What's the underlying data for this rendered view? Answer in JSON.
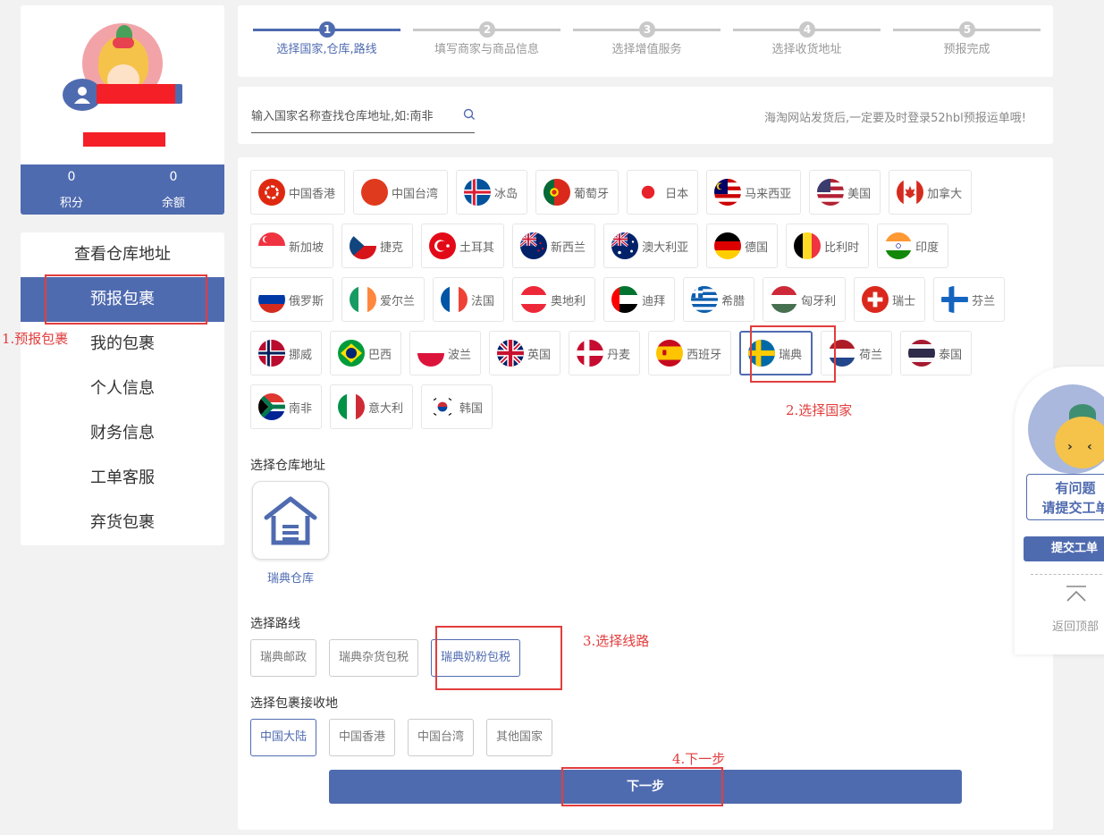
{
  "user": {
    "points_value": "0",
    "points_label": "积分",
    "balance_value": "0",
    "balance_label": "余额"
  },
  "menu": {
    "items": [
      {
        "label": "查看仓库地址"
      },
      {
        "label": "预报包裹"
      },
      {
        "label": "我的包裹"
      },
      {
        "label": "个人信息"
      },
      {
        "label": "财务信息"
      },
      {
        "label": "工单客服"
      },
      {
        "label": "弃货包裹"
      }
    ],
    "active_index": 1
  },
  "steps": [
    {
      "num": "1",
      "label": "选择国家,仓库,路线"
    },
    {
      "num": "2",
      "label": "填写商家与商品信息"
    },
    {
      "num": "3",
      "label": "选择增值服务"
    },
    {
      "num": "4",
      "label": "选择收货地址"
    },
    {
      "num": "5",
      "label": "预报完成"
    }
  ],
  "search": {
    "placeholder": "输入国家名称查找仓库地址,如:南非",
    "tip": "海淘网站发货后,一定要及时登录52hbl预报运单哦!"
  },
  "countries": [
    {
      "name": "中国香港",
      "flag": "hk-flag-icon"
    },
    {
      "name": "中国台湾",
      "flag": "tw-flag-icon"
    },
    {
      "name": "冰岛",
      "flag": "is-flag-icon"
    },
    {
      "name": "葡萄牙",
      "flag": "pt-flag-icon"
    },
    {
      "name": "日本",
      "flag": "jp-flag-icon"
    },
    {
      "name": "马来西亚",
      "flag": "my-flag-icon"
    },
    {
      "name": "美国",
      "flag": "us-flag-icon"
    },
    {
      "name": "加拿大",
      "flag": "ca-flag-icon"
    },
    {
      "name": "新加坡",
      "flag": "sg-flag-icon"
    },
    {
      "name": "捷克",
      "flag": "cz-flag-icon"
    },
    {
      "name": "土耳其",
      "flag": "tr-flag-icon"
    },
    {
      "name": "新西兰",
      "flag": "nz-flag-icon"
    },
    {
      "name": "澳大利亚",
      "flag": "au-flag-icon"
    },
    {
      "name": "德国",
      "flag": "de-flag-icon"
    },
    {
      "name": "比利时",
      "flag": "be-flag-icon"
    },
    {
      "name": "印度",
      "flag": "in-flag-icon"
    },
    {
      "name": "俄罗斯",
      "flag": "ru-flag-icon"
    },
    {
      "name": "爱尔兰",
      "flag": "ie-flag-icon"
    },
    {
      "name": "法国",
      "flag": "fr-flag-icon"
    },
    {
      "name": "奥地利",
      "flag": "at-flag-icon"
    },
    {
      "name": "迪拜",
      "flag": "ae-flag-icon"
    },
    {
      "name": "希腊",
      "flag": "gr-flag-icon"
    },
    {
      "name": "匈牙利",
      "flag": "hu-flag-icon"
    },
    {
      "name": "瑞士",
      "flag": "ch-flag-icon"
    },
    {
      "name": "芬兰",
      "flag": "fi-flag-icon"
    },
    {
      "name": "挪威",
      "flag": "no-flag-icon"
    },
    {
      "name": "巴西",
      "flag": "br-flag-icon"
    },
    {
      "name": "波兰",
      "flag": "pl-flag-icon"
    },
    {
      "name": "英国",
      "flag": "gb-flag-icon"
    },
    {
      "name": "丹麦",
      "flag": "dk-flag-icon"
    },
    {
      "name": "西班牙",
      "flag": "es-flag-icon"
    },
    {
      "name": "瑞典",
      "flag": "se-flag-icon"
    },
    {
      "name": "荷兰",
      "flag": "nl-flag-icon"
    },
    {
      "name": "泰国",
      "flag": "th-flag-icon"
    },
    {
      "name": "南非",
      "flag": "za-flag-icon"
    },
    {
      "name": "意大利",
      "flag": "it-flag-icon"
    },
    {
      "name": "韩国",
      "flag": "kr-flag-icon"
    }
  ],
  "selected_country": "瑞典",
  "warehouse": {
    "section_label": "选择仓库地址",
    "name": "瑞典仓库",
    "icon": "warehouse-icon"
  },
  "routes": {
    "section_label": "选择路线",
    "items": [
      "瑞典邮政",
      "瑞典杂货包税",
      "瑞典奶粉包税"
    ],
    "selected": "瑞典奶粉包税"
  },
  "destinations": {
    "section_label": "选择包裹接收地",
    "items": [
      "中国大陆",
      "中国香港",
      "中国台湾",
      "其他国家"
    ],
    "selected": "中国大陆"
  },
  "next_button": "下一步",
  "annotations": {
    "step1": "1.预报包裹",
    "step2": "2.选择国家",
    "step3": "3.选择线路",
    "step4": "4.下一步"
  },
  "float_widget": {
    "ask_line1": "有问题",
    "ask_line2": "请提交工单",
    "submit_ticket": "提交工单",
    "back_to_top": "返回顶部"
  },
  "colors": {
    "primary": "#4f6bb0",
    "annotation": "#e23d3d",
    "redaction": "#f51f27"
  }
}
